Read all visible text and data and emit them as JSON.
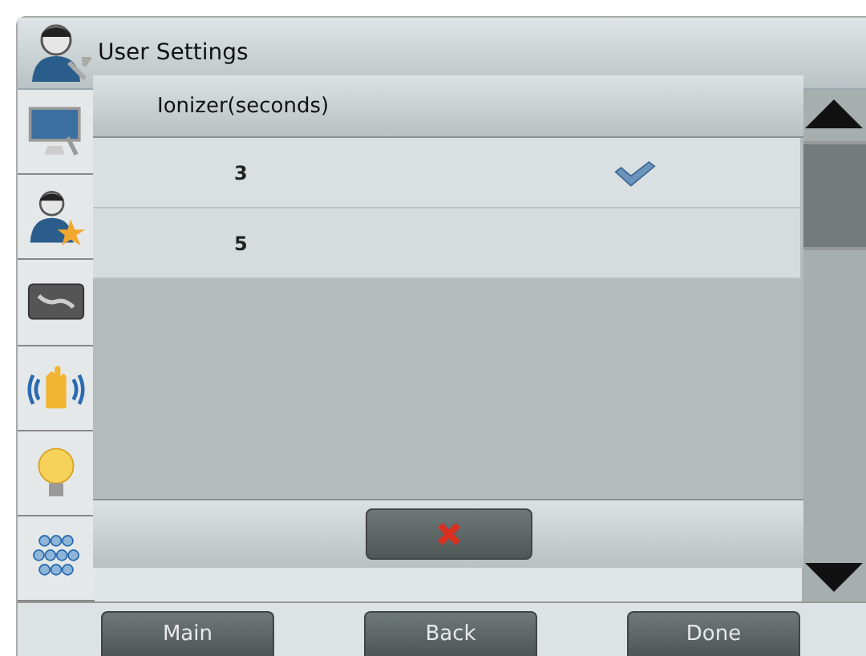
{
  "window": {
    "title": "User Settings"
  },
  "sidebar": {
    "items": [
      {
        "kind": "display"
      },
      {
        "kind": "user"
      },
      {
        "kind": "tools"
      },
      {
        "kind": "hand"
      },
      {
        "kind": "bulb"
      },
      {
        "kind": "keypad"
      }
    ]
  },
  "popup": {
    "title": "Ionizer(seconds)",
    "options": [
      {
        "value": "3",
        "selected": true
      },
      {
        "value": "5",
        "selected": false
      }
    ]
  },
  "buttons": [
    {
      "label": "Main"
    },
    {
      "label": "Back"
    },
    {
      "label": "Done"
    }
  ]
}
